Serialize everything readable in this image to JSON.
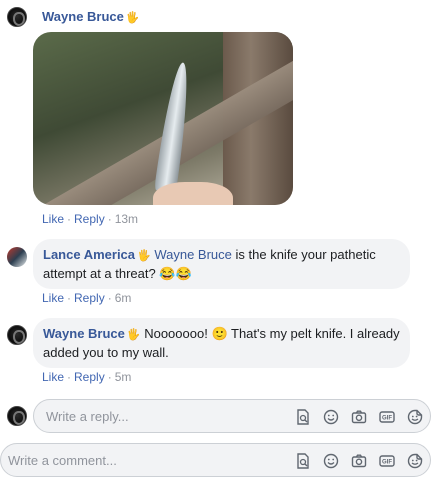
{
  "comments": [
    {
      "author": "Wayne Bruce",
      "actions": {
        "like": "Like",
        "reply": "Reply",
        "time": "13m"
      }
    },
    {
      "author": "Lance America",
      "tagged": "Wayne Bruce",
      "text": " is the knife your pathetic attempt at a threat? ",
      "emoji": "😂😂",
      "actions": {
        "like": "Like",
        "reply": "Reply",
        "time": "6m"
      }
    },
    {
      "author": "Wayne Bruce",
      "text_before_emoji": " Nooooooo! ",
      "emoji": "🙂",
      "text_after_emoji": " That's my pelt knife. I already added you to my wall.",
      "actions": {
        "like": "Like",
        "reply": "Reply",
        "time": "5m"
      }
    }
  ],
  "reply_box": {
    "placeholder": "Write a reply..."
  },
  "comment_box": {
    "placeholder": "Write a comment..."
  },
  "icons": [
    "sticker-file-icon",
    "emoji-icon",
    "camera-icon",
    "gif-icon",
    "sticker-icon"
  ],
  "wave_icon": "🖐",
  "colors": {
    "link": "#385898",
    "meta": "#90949c",
    "bubble": "#f2f3f5"
  }
}
